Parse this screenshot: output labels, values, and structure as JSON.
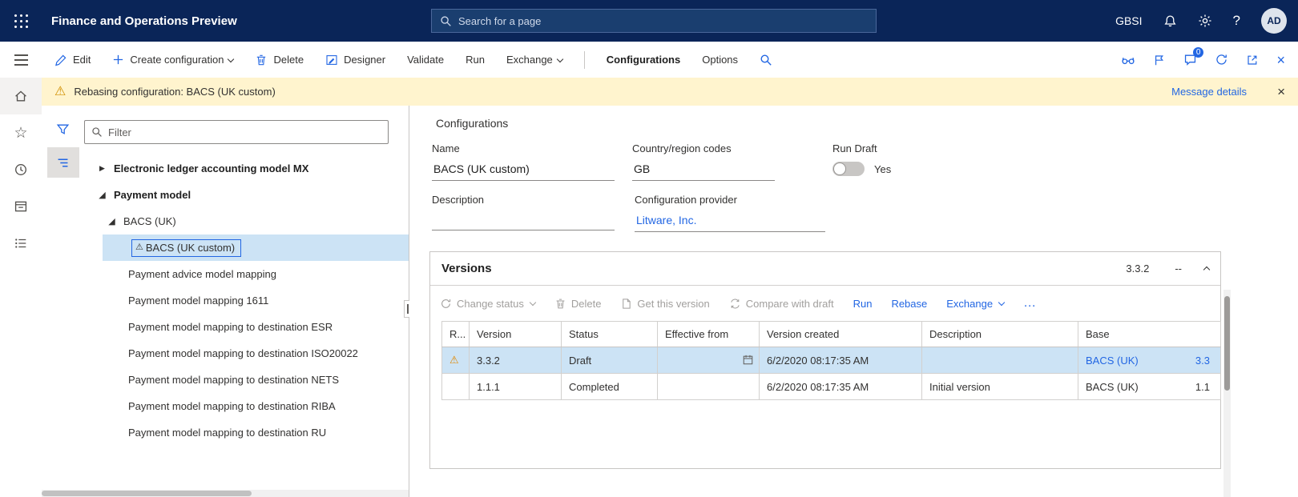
{
  "topbar": {
    "title": "Finance and Operations Preview",
    "search_placeholder": "Search for a page",
    "environment": "GBSI",
    "avatar_initials": "AD"
  },
  "actionbar": {
    "items": [
      {
        "label": "Edit"
      },
      {
        "label": "Create configuration"
      },
      {
        "label": "Delete"
      },
      {
        "label": "Designer"
      },
      {
        "label": "Validate"
      },
      {
        "label": "Run"
      },
      {
        "label": "Exchange"
      },
      {
        "label": "Configurations"
      },
      {
        "label": "Options"
      }
    ],
    "badge_count": "0"
  },
  "messagebar": {
    "text": "Rebasing configuration: BACS (UK custom)",
    "details_link": "Message details"
  },
  "tree": {
    "filter_placeholder": "Filter",
    "items": [
      {
        "label": "Electronic ledger accounting model MX"
      },
      {
        "label": "Payment model"
      },
      {
        "label": "BACS (UK)"
      },
      {
        "label": "BACS (UK custom)"
      },
      {
        "label": "Payment advice model mapping"
      },
      {
        "label": "Payment model mapping 1611"
      },
      {
        "label": "Payment model mapping to destination ESR"
      },
      {
        "label": "Payment model mapping to destination ISO20022"
      },
      {
        "label": "Payment model mapping to destination NETS"
      },
      {
        "label": "Payment model mapping to destination RIBA"
      },
      {
        "label": "Payment model mapping to destination RU"
      }
    ]
  },
  "details": {
    "section_title": "Configurations",
    "name_label": "Name",
    "name_value": "BACS (UK custom)",
    "country_label": "Country/region codes",
    "country_value": "GB",
    "run_draft_label": "Run Draft",
    "run_draft_value": "Yes",
    "description_label": "Description",
    "description_value": "",
    "provider_label": "Configuration provider",
    "provider_value": "Litware, Inc."
  },
  "versions": {
    "title": "Versions",
    "current_version": "3.3.2",
    "collapse_dash": "--",
    "toolbar": {
      "change_status": "Change status",
      "delete": "Delete",
      "get_this_version": "Get this version",
      "compare_with_draft": "Compare with draft",
      "run": "Run",
      "rebase": "Rebase",
      "exchange": "Exchange",
      "more": "…"
    },
    "columns": [
      "R...",
      "Version",
      "Status",
      "Effective from",
      "Version created",
      "Description",
      "Base"
    ],
    "rows": [
      {
        "version": "3.3.2",
        "status": "Draft",
        "effective_from": "",
        "version_created": "6/2/2020 08:17:35 AM",
        "description": "",
        "base": "BACS (UK)",
        "base_version": "3.3"
      },
      {
        "version": "1.1.1",
        "status": "Completed",
        "effective_from": "",
        "version_created": "6/2/2020 08:17:35 AM",
        "description": "Initial version",
        "base": "BACS (UK)",
        "base_version": "1.1"
      }
    ]
  },
  "icons": {
    "warning": "⚠",
    "tree_collapsed": "▶",
    "tree_expanded": "◢",
    "close": "×",
    "help": "?",
    "star": "☆"
  }
}
